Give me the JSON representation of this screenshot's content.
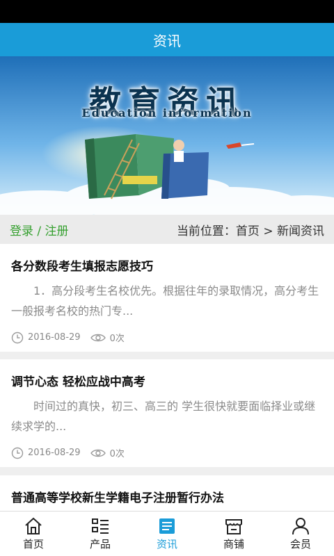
{
  "header": {
    "title": "资讯"
  },
  "banner": {
    "title_cn": "教育资讯",
    "title_en": "Education information"
  },
  "crumb_bar": {
    "login": "登录",
    "separator": " / ",
    "register": "注册",
    "location": "当前位置：首页 > 新闻资讯"
  },
  "articles": [
    {
      "title": "各分数段考生填报志愿技巧",
      "excerpt": "1．高分段考生名校优先。根据往年的录取情况，高分考生一般报考名校的热门专...",
      "date": "2016-08-29",
      "views": "0次"
    },
    {
      "title": "调节心态 轻松应战中高考",
      "excerpt": "时间过的真快，初三、高三的 学生很快就要面临择业或继续求学的...",
      "date": "2016-08-29",
      "views": "0次"
    },
    {
      "title": "普通高等学校新生学籍电子注册暂行办法"
    }
  ],
  "tabs": [
    {
      "label": "首页",
      "icon": "home-icon"
    },
    {
      "label": "产品",
      "icon": "product-list-icon"
    },
    {
      "label": "资讯",
      "icon": "news-icon",
      "active": true
    },
    {
      "label": "商铺",
      "icon": "store-icon"
    },
    {
      "label": "会员",
      "icon": "user-icon"
    }
  ],
  "colors": {
    "accent": "#1a9cd8",
    "login_green": "#35a02f"
  }
}
